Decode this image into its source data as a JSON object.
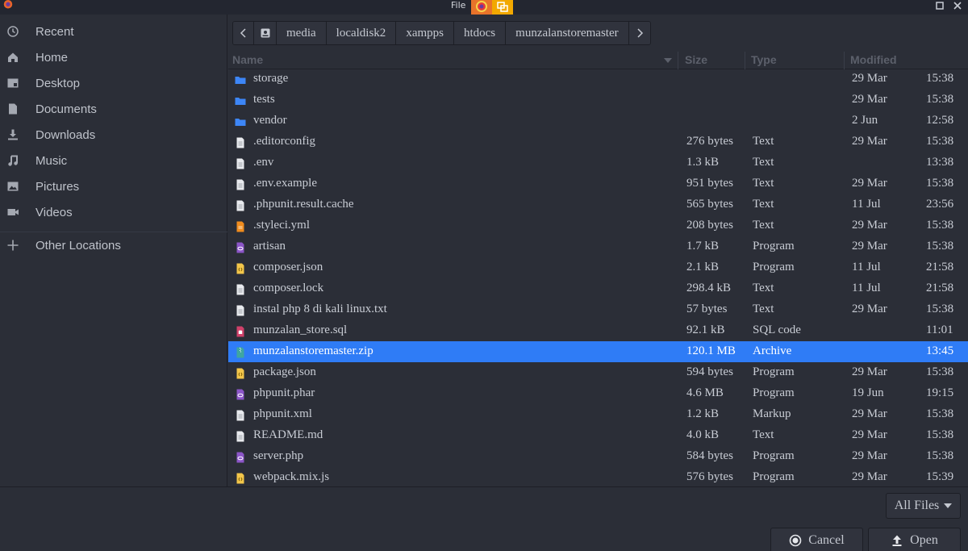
{
  "titlebar": {
    "title": "File"
  },
  "sidebar": {
    "items": [
      {
        "label": "Recent",
        "icon": "clock-icon"
      },
      {
        "label": "Home",
        "icon": "home-icon"
      },
      {
        "label": "Desktop",
        "icon": "desktop-icon"
      },
      {
        "label": "Documents",
        "icon": "documents-icon"
      },
      {
        "label": "Downloads",
        "icon": "download-icon"
      },
      {
        "label": "Music",
        "icon": "music-icon"
      },
      {
        "label": "Pictures",
        "icon": "pictures-icon"
      },
      {
        "label": "Videos",
        "icon": "videos-icon"
      }
    ],
    "other_locations": "Other Locations"
  },
  "pathbar": {
    "crumbs": [
      "media",
      "localdisk2",
      "xampps",
      "htdocs",
      "munzalanstoremaster"
    ]
  },
  "columns": {
    "name": "Name",
    "size": "Size",
    "type": "Type",
    "modified": "Modified"
  },
  "files": [
    {
      "name": "storage",
      "size": "",
      "type": "",
      "date": "29 Mar",
      "time": "15:38",
      "icon": "folder"
    },
    {
      "name": "tests",
      "size": "",
      "type": "",
      "date": "29 Mar",
      "time": "15:38",
      "icon": "folder"
    },
    {
      "name": "vendor",
      "size": "",
      "type": "",
      "date": "2 Jun",
      "time": "12:58",
      "icon": "folder"
    },
    {
      "name": ".editorconfig",
      "size": "276 bytes",
      "type": "Text",
      "date": "29 Mar",
      "time": "15:38",
      "icon": "text"
    },
    {
      "name": ".env",
      "size": "1.3 kB",
      "type": "Text",
      "date": "",
      "time": "13:38",
      "icon": "text"
    },
    {
      "name": ".env.example",
      "size": "951 bytes",
      "type": "Text",
      "date": "29 Mar",
      "time": "15:38",
      "icon": "text"
    },
    {
      "name": ".phpunit.result.cache",
      "size": "565 bytes",
      "type": "Text",
      "date": "11 Jul",
      "time": "23:56",
      "icon": "text"
    },
    {
      "name": ".styleci.yml",
      "size": "208 bytes",
      "type": "Text",
      "date": "29 Mar",
      "time": "15:38",
      "icon": "yml"
    },
    {
      "name": "artisan",
      "size": "1.7 kB",
      "type": "Program",
      "date": "29 Mar",
      "time": "15:38",
      "icon": "php"
    },
    {
      "name": "composer.json",
      "size": "2.1 kB",
      "type": "Program",
      "date": "11 Jul",
      "time": "21:58",
      "icon": "json"
    },
    {
      "name": "composer.lock",
      "size": "298.4 kB",
      "type": "Text",
      "date": "11 Jul",
      "time": "21:58",
      "icon": "text"
    },
    {
      "name": "instal php 8 di kali linux.txt",
      "size": "57 bytes",
      "type": "Text",
      "date": "29 Mar",
      "time": "15:38",
      "icon": "text"
    },
    {
      "name": "munzalan_store.sql",
      "size": "92.1 kB",
      "type": "SQL code",
      "date": "",
      "time": "11:01",
      "icon": "sql"
    },
    {
      "name": "munzalanstoremaster.zip",
      "size": "120.1 MB",
      "type": "Archive",
      "date": "",
      "time": "13:45",
      "icon": "zip",
      "selected": true
    },
    {
      "name": "package.json",
      "size": "594 bytes",
      "type": "Program",
      "date": "29 Mar",
      "time": "15:38",
      "icon": "json"
    },
    {
      "name": "phpunit.phar",
      "size": "4.6 MB",
      "type": "Program",
      "date": "19 Jun",
      "time": "19:15",
      "icon": "php"
    },
    {
      "name": "phpunit.xml",
      "size": "1.2 kB",
      "type": "Markup",
      "date": "29 Mar",
      "time": "15:38",
      "icon": "text"
    },
    {
      "name": "README.md",
      "size": "4.0 kB",
      "type": "Text",
      "date": "29 Mar",
      "time": "15:38",
      "icon": "text"
    },
    {
      "name": "server.php",
      "size": "584 bytes",
      "type": "Program",
      "date": "29 Mar",
      "time": "15:38",
      "icon": "php"
    },
    {
      "name": "webpack.mix.js",
      "size": "576 bytes",
      "type": "Program",
      "date": "29 Mar",
      "time": "15:39",
      "icon": "js"
    }
  ],
  "footer": {
    "filter": "All Files",
    "cancel": "Cancel",
    "open": "Open"
  },
  "colors": {
    "selection": "#2f7cf6",
    "folder": "#3d86f7",
    "php": "#8c56c8",
    "json": "#f3c64a",
    "sql": "#d0416a",
    "yml": "#f08c1e",
    "zip": "#3fa6a0"
  }
}
